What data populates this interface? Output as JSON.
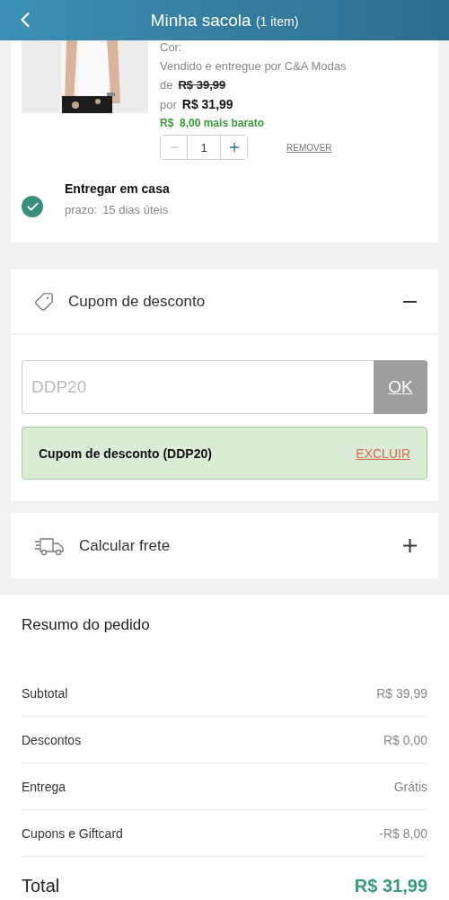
{
  "header": {
    "title": "Minha sacola",
    "count": "(1 item)"
  },
  "product": {
    "kind": "picture",
    "color_label": "Cor:",
    "seller": "Vendido e entregue por C&A Modas",
    "old_prefix": "de",
    "old_price": "R$ 39,99",
    "new_prefix": "por",
    "new_price": "R$ 31,99",
    "savings": "R$  8,00 mais barato",
    "quantity": "1",
    "remove": "REMOVER"
  },
  "delivery": {
    "selected": true,
    "title": "Entregar em casa",
    "deadline_label": "prazo:",
    "deadline": "15 dias úteis"
  },
  "coupon": {
    "title": "Cupom de desconto",
    "expanded": true,
    "placeholder": "DDP20",
    "apply": "OK",
    "applied": "Cupom de desconto (DDP20)",
    "remove": "EXCLUIR"
  },
  "shipping": {
    "title": "Calcular frete",
    "expanded": false
  },
  "summary": {
    "title": "Resumo do pedido",
    "rows": [
      {
        "label": "Subtotal",
        "value": "R$ 39,99"
      },
      {
        "label": "Descontos",
        "value": "R$ 0,00"
      },
      {
        "label": "Entrega",
        "value": "Grátis"
      },
      {
        "label": "Cupons e Giftcard",
        "value": "-R$ 8,00"
      }
    ],
    "total_label": "Total",
    "total_value": "R$ 31,99"
  }
}
